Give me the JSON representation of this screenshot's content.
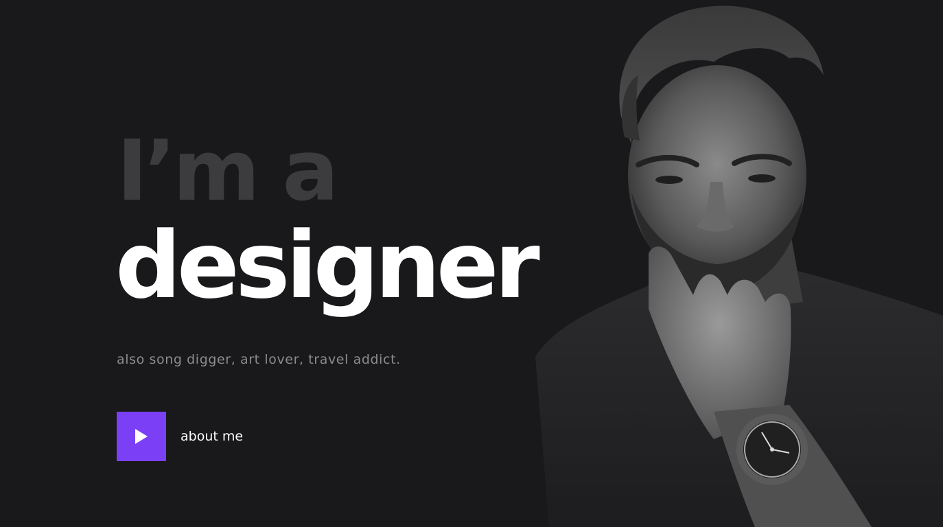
{
  "hero": {
    "headline_muted": "I’m a",
    "headline_main": "designer",
    "tagline": "also song digger, art lover, travel addict.",
    "cta_label": "about me",
    "cta_icon": "play-icon"
  },
  "colors": {
    "background": "#19191b",
    "accent": "#7b3ff5",
    "headline_muted": "#3c3c3e",
    "headline_main": "#ffffff",
    "tagline": "#8c8c8f"
  },
  "portrait": {
    "description_icon": "portrait-photo"
  }
}
